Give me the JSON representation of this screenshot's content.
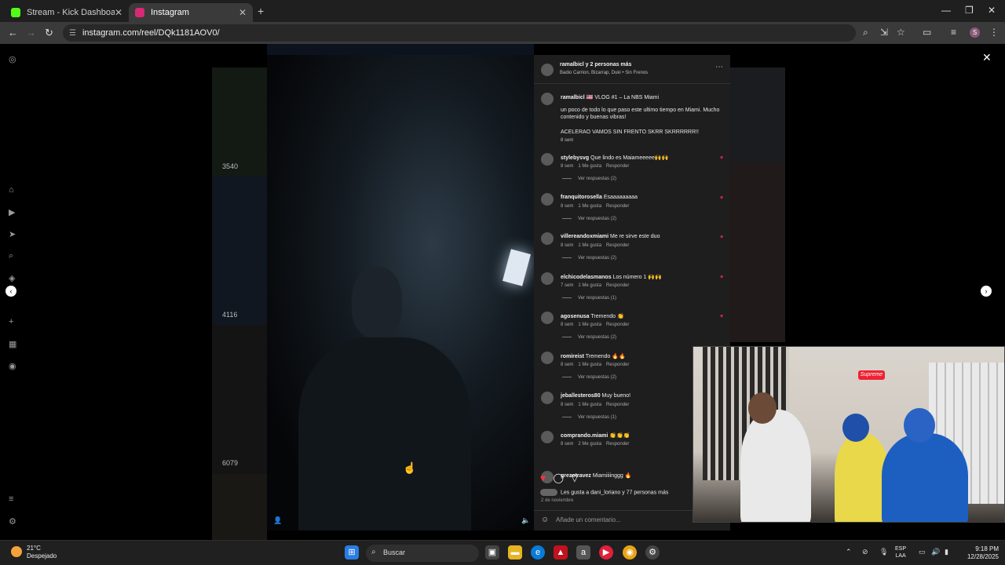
{
  "browser": {
    "tabs": [
      {
        "title": "Stream - Kick Dashboard",
        "favicon": "kick-icon",
        "color": "#53fc18"
      },
      {
        "title": "Instagram",
        "favicon": "instagram-icon",
        "color": "#d62976"
      }
    ],
    "url": "instagram.com/reel/DQk1181AOV0/"
  },
  "sidebar_counts": [
    "3540",
    "4116",
    "6079"
  ],
  "reel": {
    "header_user": "ramalbicl y 2 personas más",
    "header_sub": "Badio Carrion, Bizarrap, Duki • Sin Frenos",
    "caption_user": "ramalbicl",
    "caption_title": "🇺🇸 VLOG #1 – La NBS Miami",
    "caption_body": "un poco de todo lo que paso este ultimo tiempo en Miami. Mucho contenido y buenas vibras!",
    "caption_body2": "ACELERAO VAMOS SIN FRENTO SKRR SKRRRRRR!!",
    "caption_time": "8 sem",
    "comments": [
      {
        "user": "stylebysvg",
        "text": "Que lindo es Maiameeeee🙌🙌",
        "time": "8 sem",
        "likes": "1 Me gusta",
        "reply": "Responder",
        "replies": "Ver respuestas (2)"
      },
      {
        "user": "franquitorosella",
        "text": "Esaaaaaaaaa",
        "time": "8 sem",
        "likes": "1 Me gusta",
        "reply": "Responder",
        "replies": "Ver respuestas (2)"
      },
      {
        "user": "villereandoxmiami",
        "text": "Me re sirve este duo",
        "time": "8 sem",
        "likes": "1 Me gusta",
        "reply": "Responder",
        "replies": "Ver respuestas (2)"
      },
      {
        "user": "elchicodelasmanos",
        "text": "Los número 1 🙌🙌",
        "time": "7 sem",
        "likes": "1 Me gusta",
        "reply": "Responder",
        "replies": "Ver respuestas (1)"
      },
      {
        "user": "agosenusa",
        "text": "Tremendo 👏",
        "time": "8 sem",
        "likes": "1 Me gusta",
        "reply": "Responder",
        "replies": "Ver respuestas (2)"
      },
      {
        "user": "romireist",
        "text": "Tremendo 🔥🔥",
        "time": "8 sem",
        "likes": "1 Me gusta",
        "reply": "Responder",
        "replies": "Ver respuestas (2)"
      },
      {
        "user": "jeballesteros80",
        "text": "Muy bueno!",
        "time": "8 sem",
        "likes": "1 Me gusta",
        "reply": "Responder",
        "replies": "Ver respuestas (1)"
      },
      {
        "user": "comprando.miami",
        "text": "👏👏👏",
        "time": "8 sem",
        "likes": "2 Me gusta",
        "reply": "Responder",
        "replies": ""
      },
      {
        "user": "grezotravez",
        "text": "Miamiiiinggg 🔥",
        "time": "",
        "likes": "",
        "reply": "",
        "replies": ""
      }
    ],
    "likes_text": "Les gusta a dani_loriano y 77 personas más",
    "date": "2 de noviembre",
    "add_comment": "Añade un comentario..."
  },
  "webcam": {
    "sign": "Supreme"
  },
  "taskbar": {
    "temp": "21°C",
    "weather": "Despejado",
    "search": "Buscar",
    "lang1": "ESP",
    "lang2": "LAA",
    "time": "9:18 PM",
    "date": "12/28/2025"
  }
}
